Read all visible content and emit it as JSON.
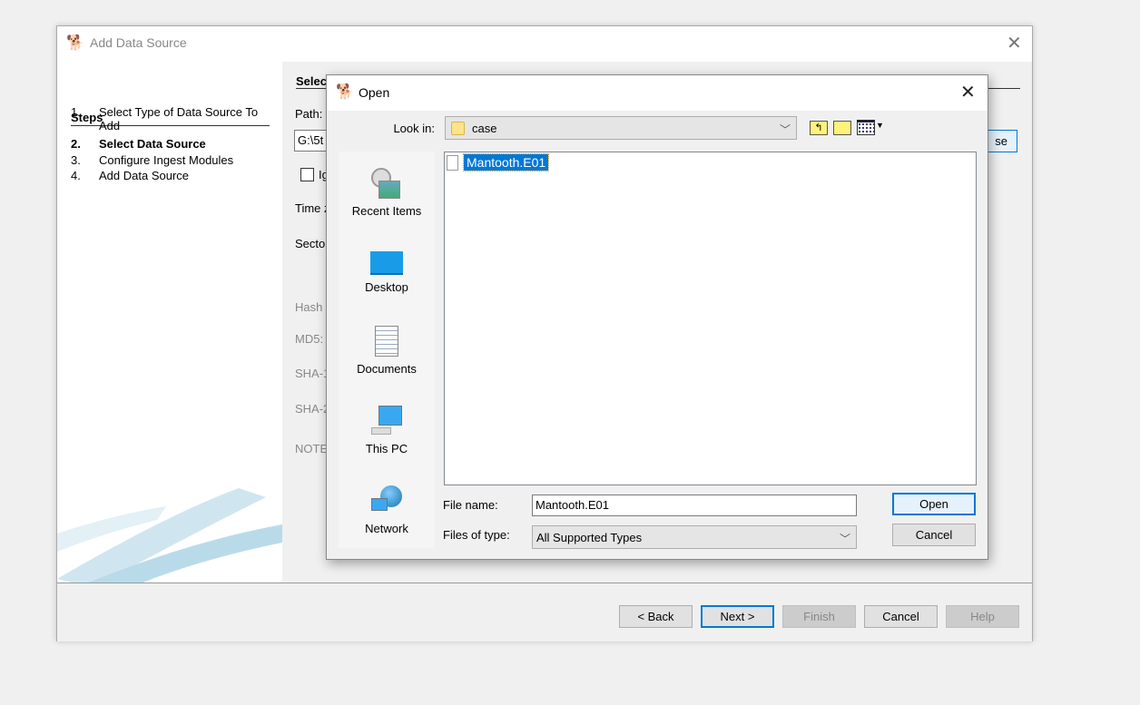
{
  "window": {
    "title": "Add Data Source"
  },
  "steps": {
    "heading": "Steps",
    "items": [
      {
        "num": "1.",
        "label": "Select Type of Data Source To Add"
      },
      {
        "num": "2.",
        "label": "Select Data Source"
      },
      {
        "num": "3.",
        "label": "Configure Ingest Modules"
      },
      {
        "num": "4.",
        "label": "Add Data Source"
      }
    ]
  },
  "panel": {
    "heading": "Selec",
    "path_label": "Path:",
    "path_value": "G:\\5t",
    "ignore_label": "Ig",
    "timezone_label": "Time z",
    "sector_label": "Secto",
    "hash_label": "Hash",
    "md5_label": "MD5:",
    "sha1_label": "SHA-1",
    "sha256_label": "SHA-2",
    "note_label": "NOTE",
    "browse_label": "se"
  },
  "footer": {
    "back": "< Back",
    "next": "Next >",
    "finish": "Finish",
    "cancel": "Cancel",
    "help": "Help"
  },
  "open_dialog": {
    "title": "Open",
    "look_in_label": "Look in:",
    "look_in_value": "case",
    "places": [
      "Recent Items",
      "Desktop",
      "Documents",
      "This PC",
      "Network"
    ],
    "files": [
      {
        "name": "Mantooth.E01",
        "selected": true
      }
    ],
    "file_name_label": "File name:",
    "file_name_value": "Mantooth.E01",
    "file_type_label": "Files of type:",
    "file_type_value": "All Supported Types",
    "open_button": "Open",
    "cancel_button": "Cancel"
  },
  "colors": {
    "accent": "#0078d7",
    "selection": "#0078d7"
  }
}
